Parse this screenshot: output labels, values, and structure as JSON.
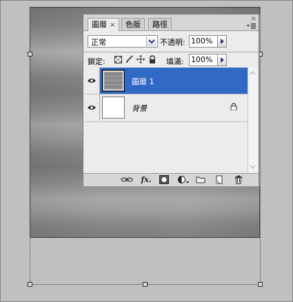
{
  "panel": {
    "tabs": [
      {
        "label": "圖層",
        "active": true,
        "close_glyph": "×"
      },
      {
        "label": "色版",
        "active": false
      },
      {
        "label": "路徑",
        "active": false
      }
    ],
    "close_glyph": "×",
    "blend_mode": "正常",
    "opacity_label": "不透明:",
    "opacity_value": "100%",
    "lock_label": "鎖定:",
    "fill_label": "填滿:",
    "fill_value": "100%",
    "layers": [
      {
        "name": "圖層 1",
        "selected": true,
        "visible": true,
        "locked": false
      },
      {
        "name": "背景",
        "selected": false,
        "visible": true,
        "locked": true
      }
    ],
    "bottom_icons": [
      "link-icon",
      "fx-icon",
      "mask-icon",
      "adjustment-icon",
      "group-folder-icon",
      "new-layer-icon",
      "trash-icon"
    ],
    "fx_label": "fx."
  },
  "colors": {
    "selection": "#3169c6",
    "panel_bg": "#ececec",
    "workspace": "#c0c0c0"
  }
}
